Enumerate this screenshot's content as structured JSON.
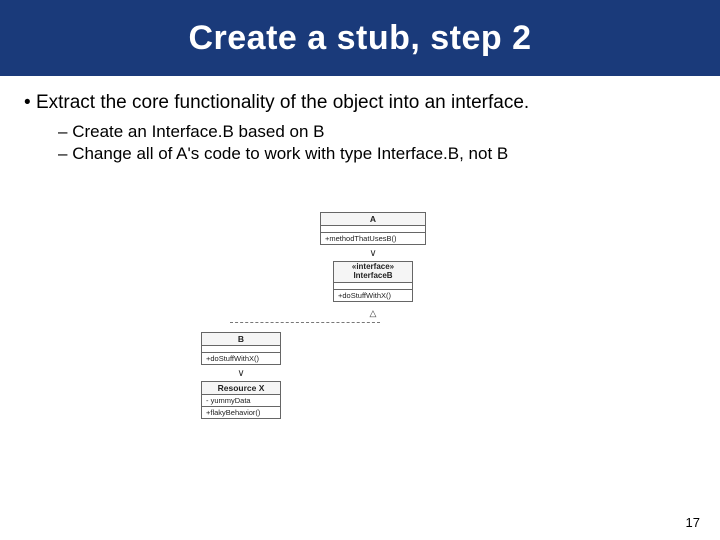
{
  "title": "Create a stub, step 2",
  "main_bullet": "Extract the core functionality of the object into an interface.",
  "sub_bullets": [
    "Create an Interface.B based on B",
    "Change all of A's code to work with type Interface.B, not B"
  ],
  "uml": {
    "a_title": "A",
    "a_method": "+methodThatUsesB()",
    "iface_stereo": "«interface»",
    "iface_name": "InterfaceB",
    "iface_method": "+doStuffWithX()",
    "b_title": "B",
    "b_method": "+doStuffWithX()",
    "x_title": "Resource X",
    "x_row1": "- yummyData",
    "x_row2": "+flakyBehavior()"
  },
  "page_number": "17"
}
